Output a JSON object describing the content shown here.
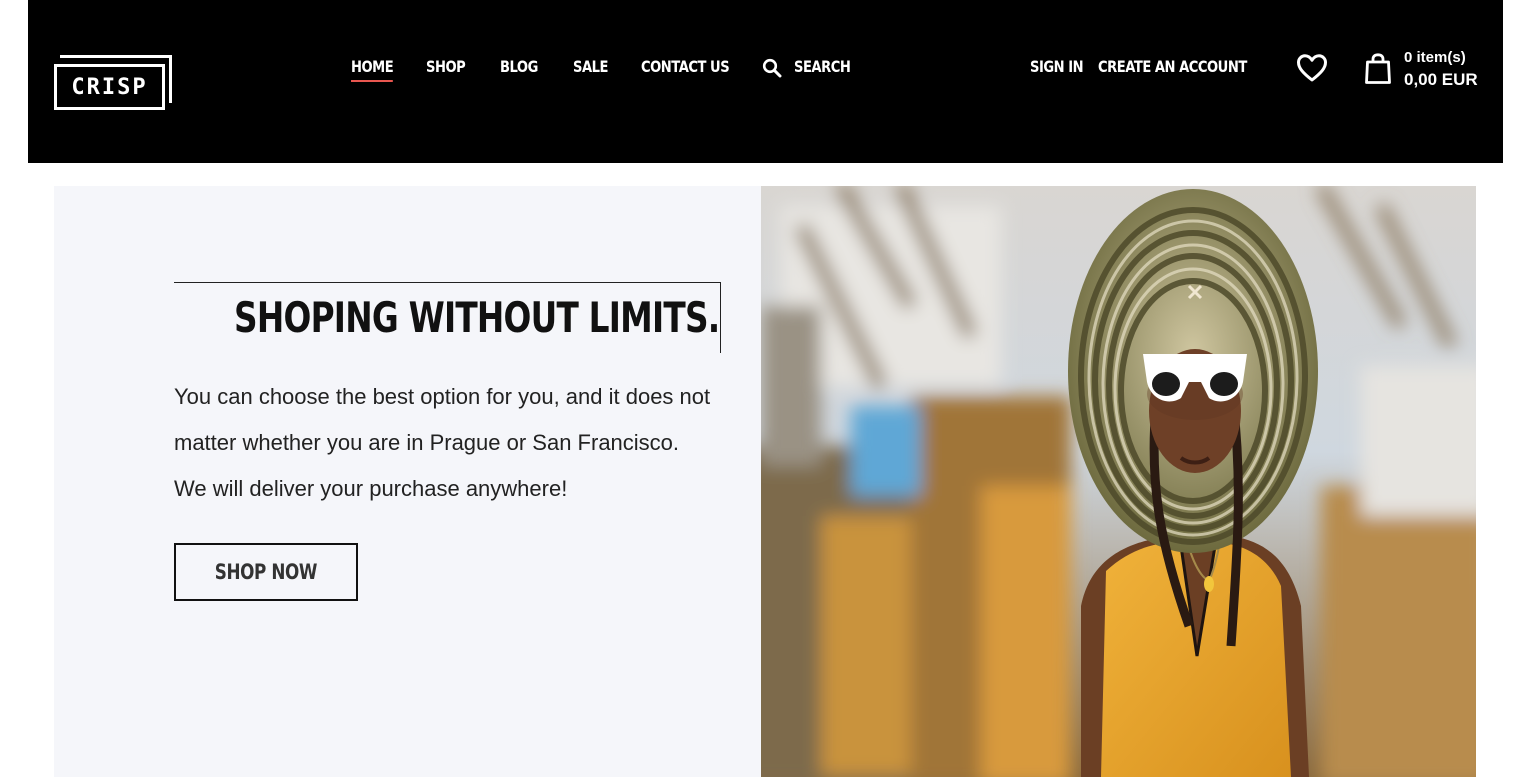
{
  "header": {
    "logo_text": "CRISP",
    "nav": {
      "home": "HOME",
      "shop": "SHOP",
      "blog": "BLOG",
      "sale": "SALE",
      "contact": "CONTACT US",
      "search": "SEARCH"
    },
    "account": {
      "sign_in": "SIGN IN",
      "create_account": "CREATE AN ACCOUNT"
    },
    "cart": {
      "count": "0 item(s)",
      "total": "0,00 EUR"
    },
    "icons": {
      "search": "search-icon",
      "wishlist": "heart-icon",
      "cart": "shopping-bag-icon"
    },
    "accent_color": "#e8564f"
  },
  "hero": {
    "title": "SHOPING WITHOUT LIMITS.",
    "text": "You can choose the best option for you, and it does not matter whether you are in Prague or San Francisco. We will deliver your purchase anywhere!",
    "button_label": "SHOP NOW",
    "background_color": "#f5f6fa"
  }
}
